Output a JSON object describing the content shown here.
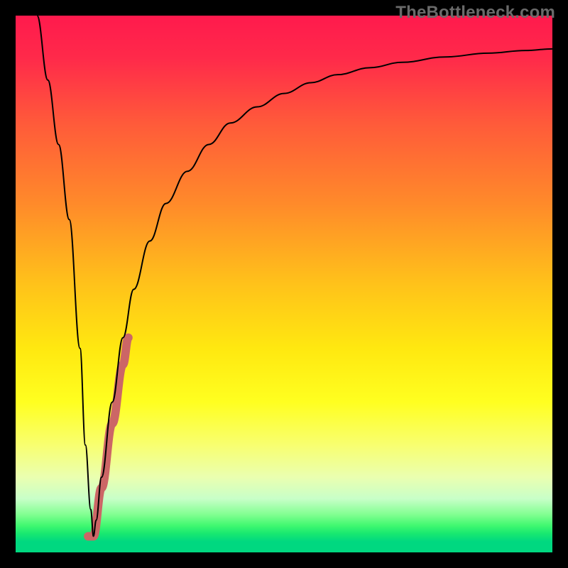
{
  "watermark": "TheBottleneck.com",
  "chart_data": {
    "type": "line",
    "title": "",
    "xlabel": "",
    "ylabel": "",
    "xlim": [
      0,
      100
    ],
    "ylim": [
      0,
      100
    ],
    "background_gradient": {
      "stops": [
        {
          "offset": 0.0,
          "color": "#ff1a4d"
        },
        {
          "offset": 0.08,
          "color": "#ff2a4a"
        },
        {
          "offset": 0.2,
          "color": "#ff5a3a"
        },
        {
          "offset": 0.35,
          "color": "#ff8a2a"
        },
        {
          "offset": 0.5,
          "color": "#ffc21a"
        },
        {
          "offset": 0.62,
          "color": "#ffe810"
        },
        {
          "offset": 0.72,
          "color": "#ffff20"
        },
        {
          "offset": 0.8,
          "color": "#f8ff70"
        },
        {
          "offset": 0.86,
          "color": "#eaffb0"
        },
        {
          "offset": 0.9,
          "color": "#c8ffc8"
        },
        {
          "offset": 0.93,
          "color": "#80ff90"
        },
        {
          "offset": 0.95,
          "color": "#40f870"
        },
        {
          "offset": 0.965,
          "color": "#18e870"
        },
        {
          "offset": 0.98,
          "color": "#00d880"
        },
        {
          "offset": 1.0,
          "color": "#00d880"
        }
      ]
    },
    "series": [
      {
        "name": "bottleneck-curve-left",
        "stroke": "#000000",
        "stroke_width": 2,
        "x": [
          4,
          6,
          8,
          10,
          12,
          13,
          14,
          14.5
        ],
        "y": [
          100,
          88,
          76,
          62,
          38,
          20,
          8,
          3
        ]
      },
      {
        "name": "bottleneck-curve-right",
        "stroke": "#000000",
        "stroke_width": 2,
        "x": [
          14.5,
          15,
          16,
          18,
          20,
          22,
          25,
          28,
          32,
          36,
          40,
          45,
          50,
          55,
          60,
          66,
          72,
          80,
          88,
          95,
          100
        ],
        "y": [
          3,
          6,
          14,
          28,
          40,
          49,
          58,
          65,
          71,
          76,
          80,
          83,
          85.5,
          87.5,
          89,
          90.3,
          91.3,
          92.3,
          93,
          93.5,
          93.8
        ]
      },
      {
        "name": "highlight-segment",
        "stroke": "#cc6666",
        "stroke_width": 12,
        "linecap": "round",
        "x": [
          13.5,
          14.5,
          16,
          18,
          20,
          21
        ],
        "y": [
          3,
          3,
          12,
          24,
          35,
          40
        ]
      }
    ]
  }
}
